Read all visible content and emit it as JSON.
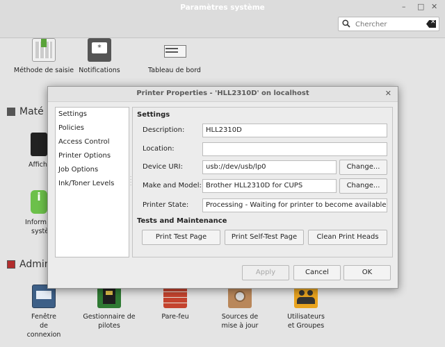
{
  "background_window": {
    "title": "Paramètres système",
    "controls": {
      "minimize": "–",
      "maximize": "□",
      "close": "✕"
    },
    "search": {
      "placeholder": "Chercher",
      "value": ""
    },
    "top_items": [
      {
        "label": "Méthode de saisie",
        "icon": "keyboard-icon"
      },
      {
        "label": "Notifications",
        "icon": "notifications-icon"
      },
      {
        "label": "Tableau de bord",
        "icon": "panel-icon"
      }
    ],
    "sections": [
      {
        "title": "Matériel",
        "visible_title": "Maté",
        "items": [
          {
            "label": "Affichage",
            "visible_label": "Affich",
            "icon": "display-icon"
          },
          {
            "label": "Informations système",
            "visible_line1": "Inform",
            "visible_line2": "systè",
            "icon": "info-icon"
          }
        ]
      },
      {
        "title": "Administration",
        "visible_title": "Admin",
        "items": [
          {
            "label": "Fenêtre de connexion",
            "icon": "login-window-icon"
          },
          {
            "label": "Gestionnaire de pilotes",
            "icon": "driver-manager-icon"
          },
          {
            "label": "Pare-feu",
            "icon": "firewall-icon"
          },
          {
            "label": "Sources de mise à jour",
            "icon": "software-sources-icon"
          },
          {
            "label": "Utilisateurs et Groupes",
            "icon": "users-groups-icon"
          }
        ]
      }
    ]
  },
  "dialog": {
    "title": "Printer Properties - 'HLL2310D' on localhost",
    "close": "✕",
    "sidebar": [
      "Settings",
      "Policies",
      "Access Control",
      "Printer Options",
      "Job Options",
      "Ink/Toner Levels"
    ],
    "settings_header": "Settings",
    "fields": {
      "description": {
        "label": "Description:",
        "value": "HLL2310D"
      },
      "location": {
        "label": "Location:",
        "value": ""
      },
      "device_uri": {
        "label": "Device URI:",
        "value": "usb://dev/usb/lp0",
        "button": "Change..."
      },
      "make_model": {
        "label": "Make and Model:",
        "value": "Brother HLL2310D for CUPS",
        "button": "Change..."
      },
      "state": {
        "label": "Printer State:",
        "value": "Processing - Waiting for printer to become available."
      }
    },
    "tests_header": "Tests and Maintenance",
    "tests": {
      "print_test": "Print Test Page",
      "self_test": "Print Self-Test Page",
      "clean_heads": "Clean Print Heads"
    },
    "buttons": {
      "apply": "Apply",
      "cancel": "Cancel",
      "ok": "OK"
    }
  }
}
